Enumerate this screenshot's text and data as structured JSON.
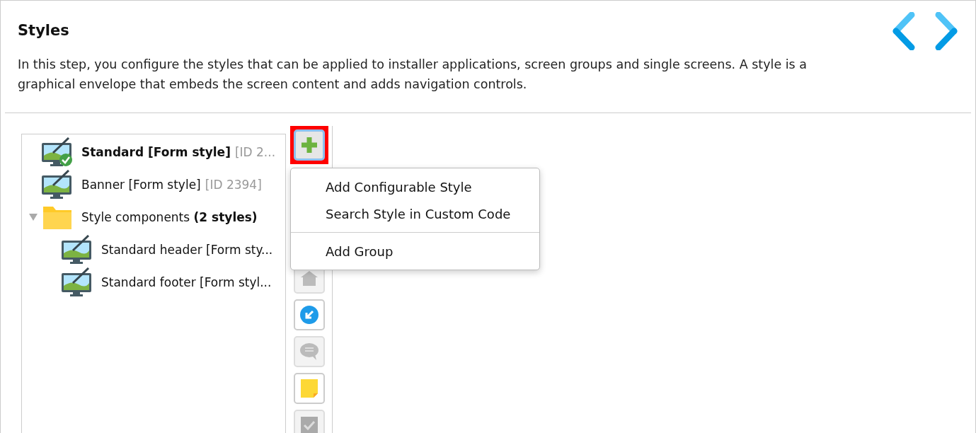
{
  "header": {
    "title": "Styles",
    "description": "In this step, you configure the styles that can be applied to installer applications, screen groups and single screens. A style is a graphical envelope that embeds the screen content and adds navigation controls."
  },
  "tree": [
    {
      "kind": "style",
      "label": "Standard [Form style]",
      "bold": true,
      "note": "[ID 2...",
      "default": true
    },
    {
      "kind": "style",
      "label": "Banner [Form style]",
      "bold": false,
      "note": "[ID 2394]",
      "default": false
    },
    {
      "kind": "folder",
      "label": "Style components **(2 styles)**",
      "bold": false,
      "expanded": true,
      "children": [
        {
          "kind": "style",
          "label": "Standard header [Form sty...",
          "bold": false,
          "default": false
        },
        {
          "kind": "style",
          "label": "Standard footer [Form styl...",
          "bold": false,
          "default": false
        }
      ]
    }
  ],
  "toolbar": [
    {
      "kind": "add",
      "disabled": false,
      "highlighted": true
    },
    {
      "kind": "home",
      "disabled": true,
      "highlighted": false
    },
    {
      "kind": "back",
      "disabled": false,
      "highlighted": false
    },
    {
      "kind": "comment",
      "disabled": true,
      "highlighted": false
    },
    {
      "kind": "note",
      "disabled": false,
      "highlighted": false
    },
    {
      "kind": "check",
      "disabled": true,
      "highlighted": false
    }
  ],
  "menu": [
    {
      "kind": "item",
      "label": "Add Configurable Style"
    },
    {
      "kind": "item",
      "label": "Search Style in Custom Code"
    },
    {
      "kind": "separator"
    },
    {
      "kind": "item",
      "label": "Add Group"
    }
  ]
}
